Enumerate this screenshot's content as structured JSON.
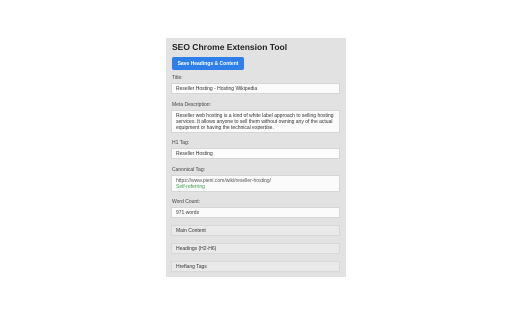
{
  "app": {
    "title": "SEO Chrome Extension Tool"
  },
  "actions": {
    "save_label": "Save Headings & Content"
  },
  "fields": {
    "title": {
      "label": "Title:",
      "value": "Reseller Hosting - Hosting Wikipedia"
    },
    "meta": {
      "label": "Meta Description:",
      "value": "Reseller web hosting is a kind of white label approach to selling hosting services. It allows anyone to sell them without owning any of the actual equipment or having the technical expertise."
    },
    "h1": {
      "label": "H1 Tag:",
      "value": "Reseller Hosting"
    },
    "canonical": {
      "label": "Canonical Tag:",
      "url": "https://www.pieni.com/wiki/reseller-hosting/",
      "status": "Self-referring"
    },
    "wordcount": {
      "label": "Word Count:",
      "value": "971 words"
    }
  },
  "sections": [
    {
      "label": "Main Content"
    },
    {
      "label": "Headings (H2-H6)"
    },
    {
      "label": "Hreflang Tags"
    }
  ],
  "colors": {
    "accent": "#2e7fea",
    "status_ok": "#3da34b",
    "panel_bg": "#e2e2e2"
  }
}
